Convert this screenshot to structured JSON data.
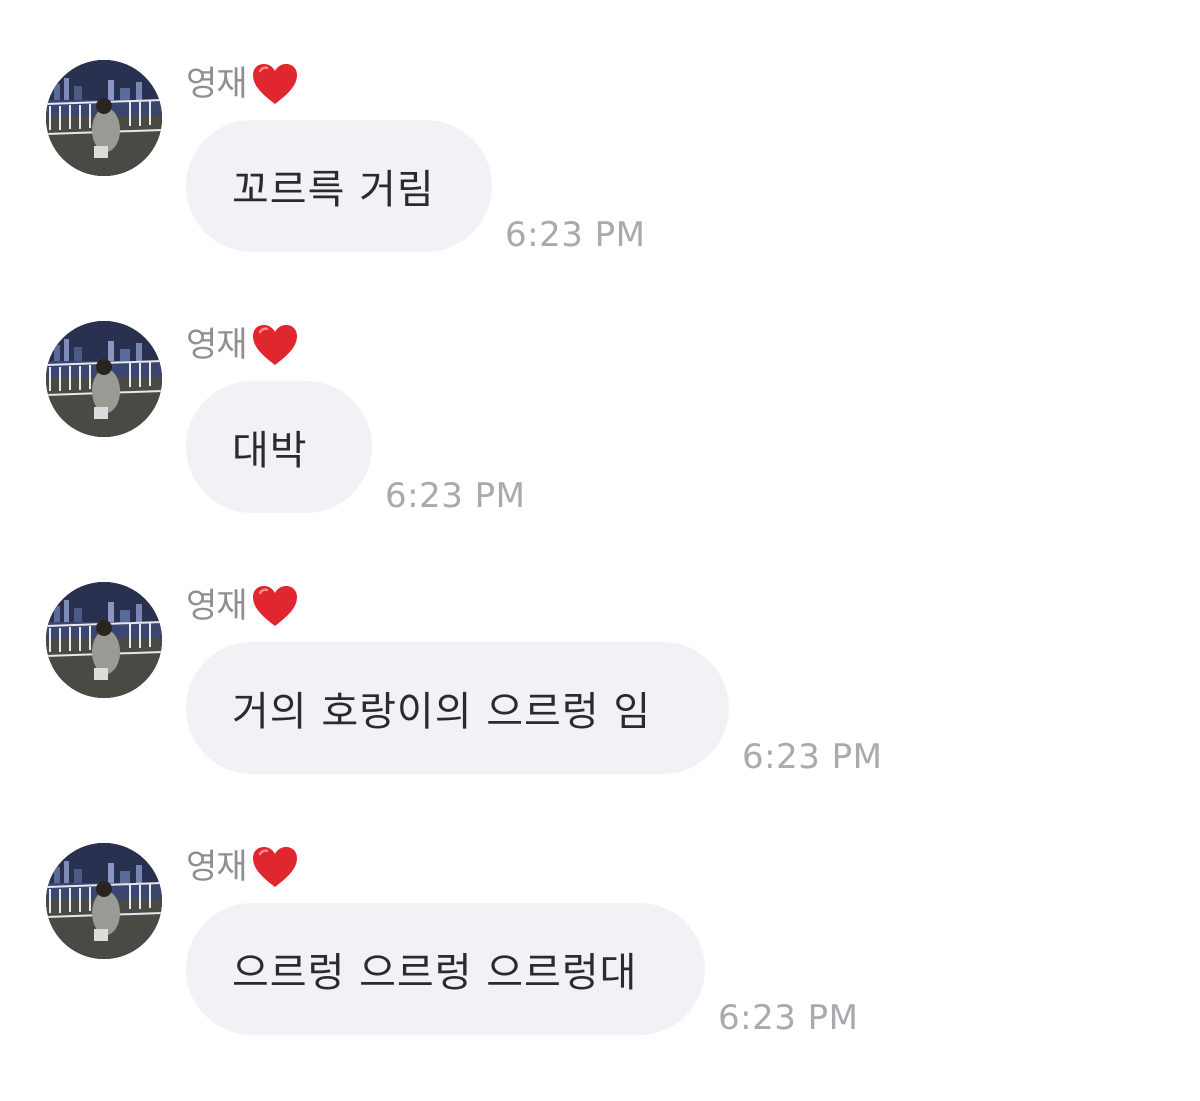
{
  "sender": {
    "name": "영재",
    "emoji": "❤️"
  },
  "messages": [
    {
      "text": "꼬르륵 거림",
      "time": "6:23 PM"
    },
    {
      "text": "대박",
      "time": "6:23 PM"
    },
    {
      "text": "거의 호랑이의 으르렁 임",
      "time": "6:23 PM"
    },
    {
      "text": "으르렁 으르렁 으르렁대",
      "time": "6:23 PM"
    }
  ],
  "colors": {
    "bubble": "#f2f2f6",
    "text": "#2b2b2e",
    "meta": "#8e8e93",
    "heart": "#e0262e"
  }
}
